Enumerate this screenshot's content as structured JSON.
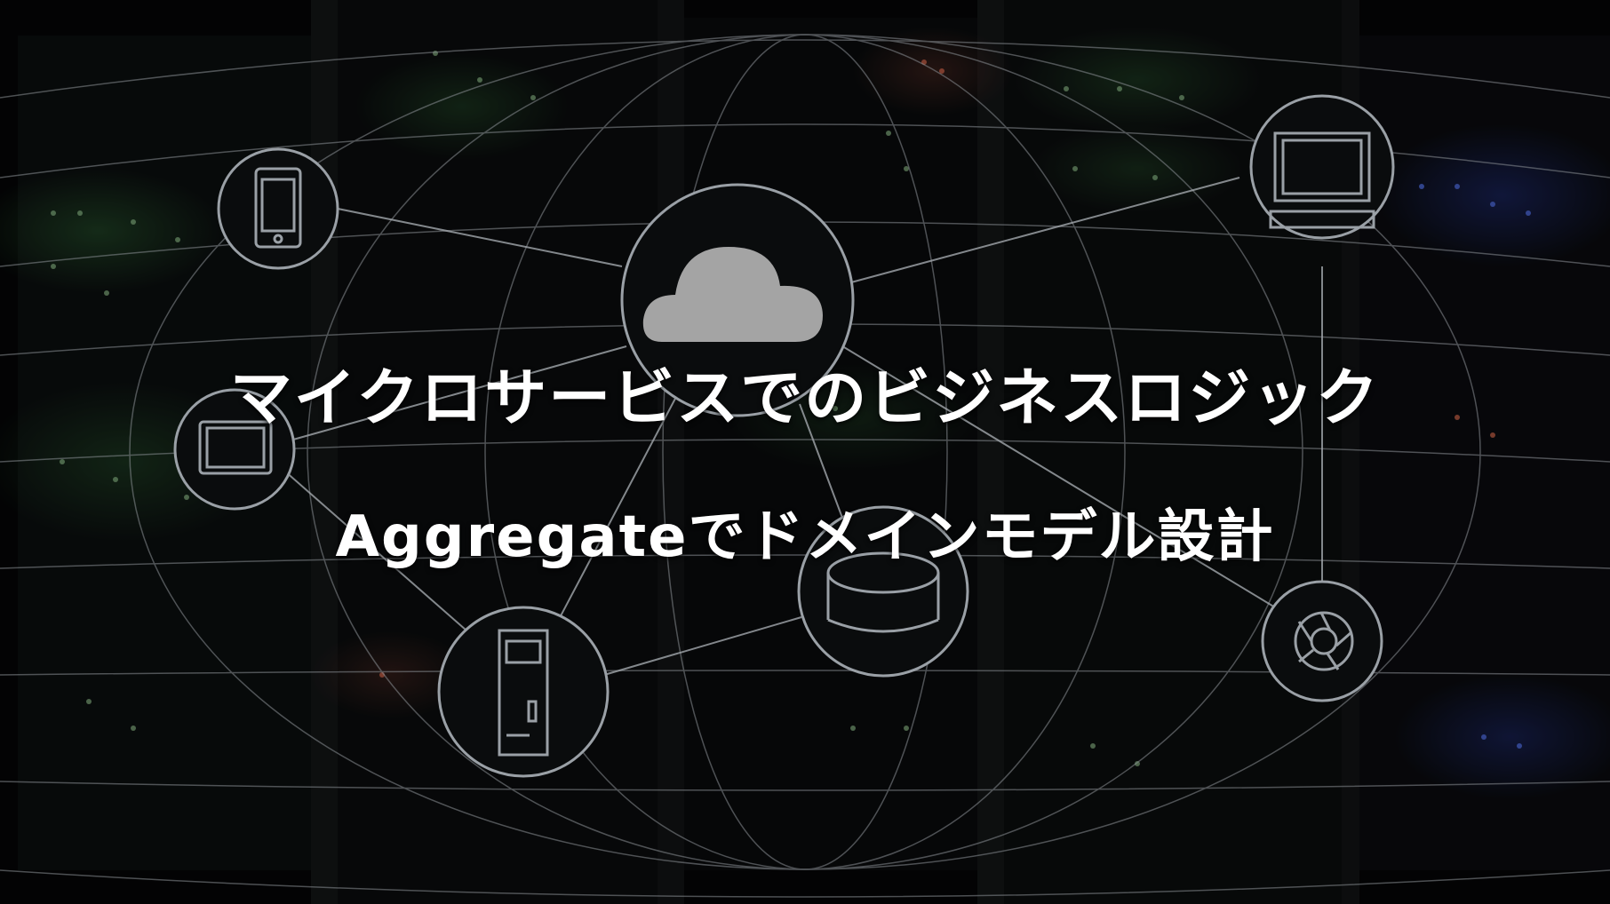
{
  "title": {
    "line1": "マイクロサービスでのビジネスロジック",
    "line2": "Aggregateでドメインモデル設計"
  },
  "icons": {
    "cloud": "cloud-icon",
    "smartphone": "smartphone-icon",
    "monitor": "desktop-monitor-icon",
    "tablet": "tablet-icon",
    "database": "database-icon",
    "server_tower": "server-tower-icon",
    "camera_aperture": "camera-aperture-icon"
  },
  "colors": {
    "background": "#050607",
    "network_lines": "#8a8f94",
    "icon_stroke": "#9aa0a6",
    "cloud_fill": "#a4a4a4",
    "text": "#ffffff"
  }
}
